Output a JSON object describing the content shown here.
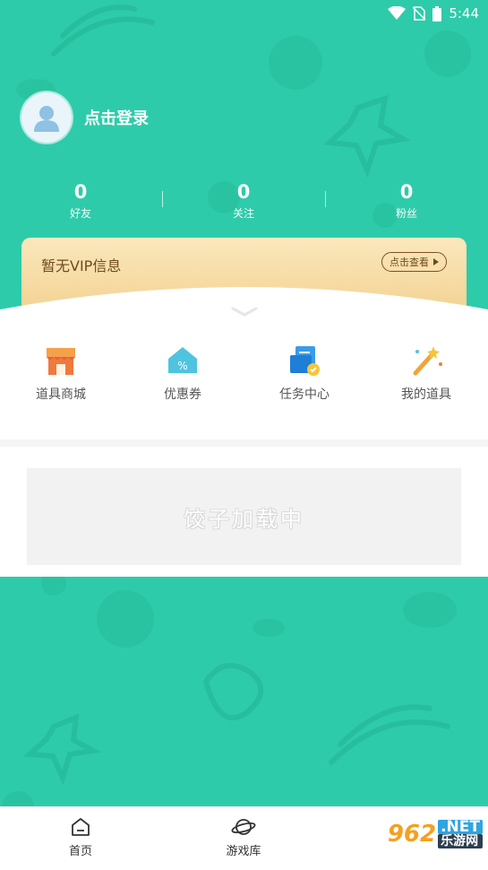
{
  "status_bar": {
    "time": "5:44"
  },
  "profile": {
    "login_text": "点击登录"
  },
  "stats": [
    {
      "value": "0",
      "label": "好友"
    },
    {
      "value": "0",
      "label": "关注"
    },
    {
      "value": "0",
      "label": "粉丝"
    }
  ],
  "vip": {
    "text": "暂无VIP信息",
    "button": "点击查看"
  },
  "menu": [
    {
      "label": "道具商城",
      "icon": "shop-icon"
    },
    {
      "label": "优惠券",
      "icon": "coupon-icon"
    },
    {
      "label": "任务中心",
      "icon": "task-icon"
    },
    {
      "label": "我的道具",
      "icon": "magic-wand-icon"
    }
  ],
  "ad": {
    "text": "饺子加载中"
  },
  "bottom_nav": [
    {
      "label": "首页",
      "icon": "home-icon"
    },
    {
      "label": "游戏库",
      "icon": "planet-icon"
    }
  ],
  "watermark": {
    "num": "962",
    "net": ".NET",
    "cn": "乐游网"
  },
  "colors": {
    "primary": "#2ECBAA",
    "vip_bg": "#F6DDA6",
    "vip_text": "#6E4A1E"
  }
}
